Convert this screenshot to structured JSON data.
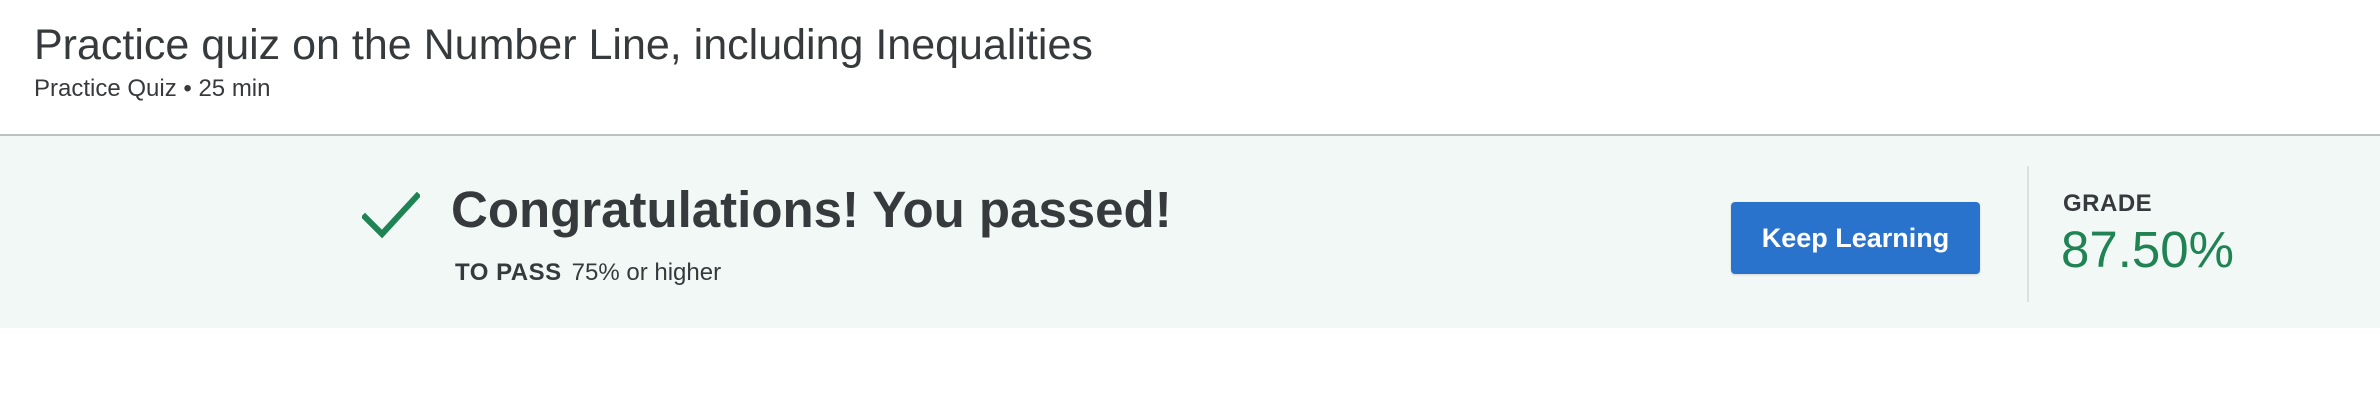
{
  "header": {
    "title": "Practice quiz on the Number Line, including Inequalities",
    "subtitle": "Practice Quiz • 25 min"
  },
  "result": {
    "icon": "checkmark-icon",
    "message": "Congratulations! You passed!",
    "pass_label": "TO PASS",
    "pass_value": "75% or higher",
    "button_label": "Keep Learning",
    "grade_label": "GRADE",
    "grade_value": "87.50%"
  },
  "colors": {
    "banner_bg": "#f2f8f6",
    "success_green": "#1f8354",
    "button_blue": "#2a73cc",
    "text": "#373a3c"
  }
}
